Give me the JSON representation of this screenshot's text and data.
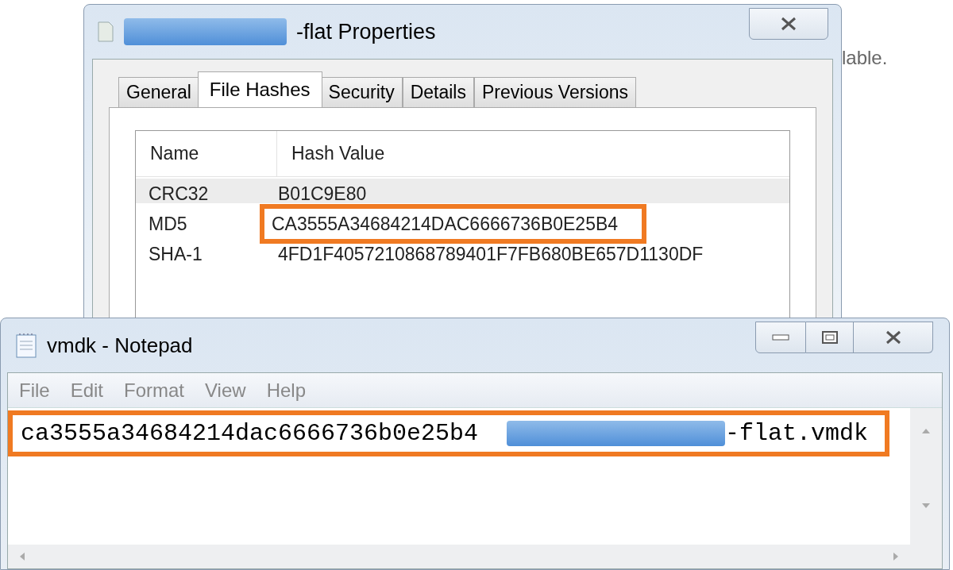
{
  "background_text": "lable.",
  "properties": {
    "title_suffix": "-flat Properties",
    "tabs": [
      {
        "label": "General",
        "selected": false
      },
      {
        "label": "File Hashes",
        "selected": true
      },
      {
        "label": "Security",
        "selected": false
      },
      {
        "label": "Details",
        "selected": false
      },
      {
        "label": "Previous Versions",
        "selected": false
      }
    ],
    "columns": [
      "Name",
      "Hash Value"
    ],
    "rows": [
      {
        "name": "CRC32",
        "value": "B01C9E80",
        "selected": true,
        "highlighted": false
      },
      {
        "name": "MD5",
        "value": "CA3555A34684214DAC6666736B0E25B4",
        "selected": false,
        "highlighted": true
      },
      {
        "name": "SHA-1",
        "value": "4FD1F4057210868789401F7FB680BE657D1130DF",
        "selected": false,
        "highlighted": false
      }
    ]
  },
  "notepad": {
    "title": "vmdk - Notepad",
    "menu": [
      "File",
      "Edit",
      "Format",
      "View",
      "Help"
    ],
    "line": {
      "hash": "ca3555a34684214dac6666736b0e25b4",
      "filename_suffix": "-flat.vmdk",
      "highlighted": true
    }
  }
}
